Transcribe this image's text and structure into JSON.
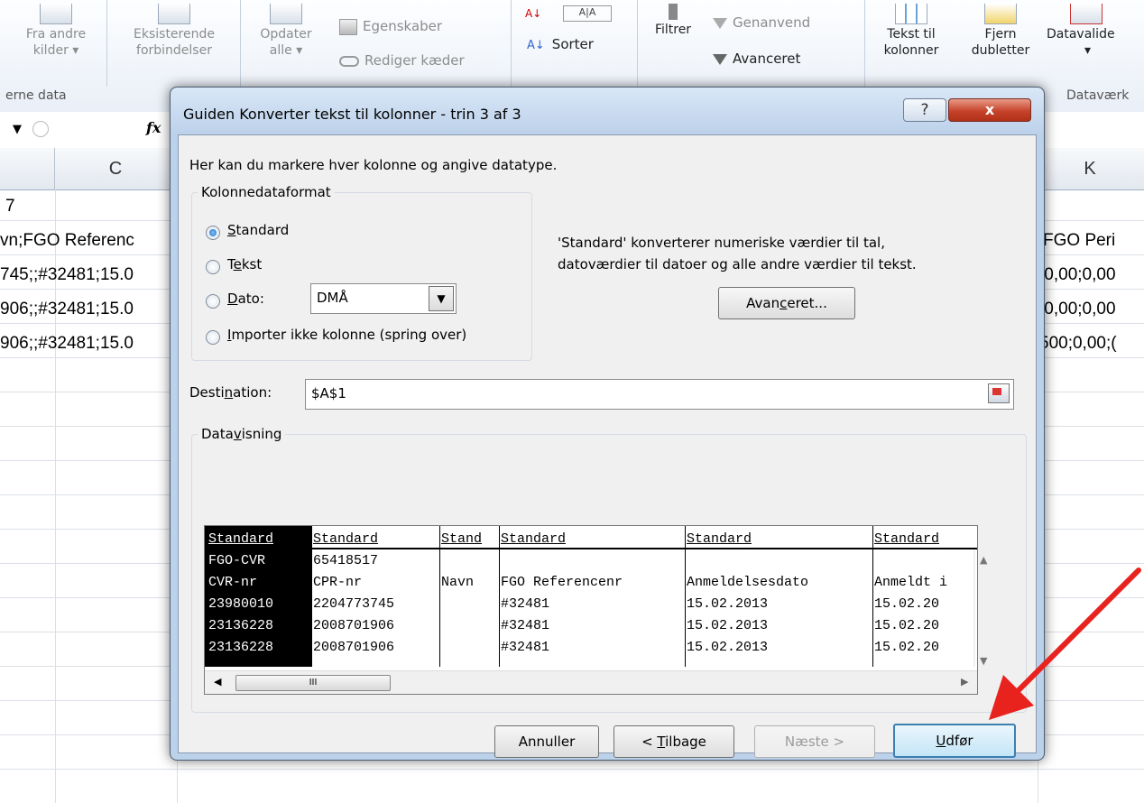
{
  "ribbon": {
    "buttons": [
      {
        "label1": "Fra andre",
        "label2": "kilder ▾"
      },
      {
        "label1": "Eksisterende",
        "label2": "forbindelser"
      },
      {
        "label1": "Opdater",
        "label2": "alle ▾"
      },
      {
        "label1": "Tekst til",
        "label2": "kolonner"
      },
      {
        "label1": "Fjern",
        "label2": "dubletter"
      },
      {
        "label1": "Datavalide",
        "label2": "▾"
      }
    ],
    "small": {
      "egenskaber": "Egenskaber",
      "rediger": "Rediger kæder",
      "sorter": "Sorter",
      "filtrer": "Filtrer",
      "genanvend": "Genanvend",
      "avanceret": "Avanceret"
    },
    "groups": {
      "external": "erne data",
      "datatools": "Dataværk"
    }
  },
  "formula_bar": {
    "fx": "fx"
  },
  "columns": [
    "C",
    "K"
  ],
  "cells": {
    "c1": "7",
    "c2": "vn;FGO Referenc",
    "c3": "745;;#32481;15.0",
    "c4": "906;;#32481;15.0",
    "c5": "906;;#32481;15.0",
    "k2": "FGO Peri",
    "k3": ";0,00;0,00",
    "k4": ";0,00;0,00",
    "k5": "500;0,00;("
  },
  "dialog": {
    "title": "Guiden Konverter tekst til kolonner - trin 3 af 3",
    "help": "?",
    "close": "x",
    "intro": "Her kan du markere hver kolonne og angive datatype.",
    "format_legend": "Kolonnedataformat",
    "radios": [
      {
        "pre": "",
        "u": "S",
        "post": "tandard",
        "selected": true
      },
      {
        "pre": "T",
        "u": "e",
        "post": "kst",
        "selected": false
      },
      {
        "pre": "",
        "u": "D",
        "post": "ato:",
        "selected": false
      },
      {
        "pre": "",
        "u": "I",
        "post": "mporter ikke kolonne (spring over)",
        "selected": false
      }
    ],
    "date_format": "DMÅ",
    "description_line1": "'Standard' konverterer numeriske værdier til tal,",
    "description_line2": "datoværdier til datoer og alle andre værdier til tekst.",
    "advanced_button": {
      "pre": "Avan",
      "u": "c",
      "post": "eret..."
    },
    "destination_label": {
      "pre": "Desti",
      "u": "n",
      "post": "ation:"
    },
    "destination_value": "$A$1",
    "preview_legend": {
      "pre": "Data",
      "u": "v",
      "post": "isning"
    },
    "preview": {
      "headers": [
        "Standard",
        "Standard",
        "Stand",
        "Standard",
        "Standard",
        "Standard"
      ],
      "rows": [
        [
          "FGO-CVR",
          "65418517",
          "",
          "",
          "",
          ""
        ],
        [
          "CVR-nr",
          "CPR-nr",
          "Navn",
          "FGO Referencenr",
          "Anmeldelsesdato",
          "Anmeldt i"
        ],
        [
          "23980010",
          "2204773745",
          "",
          "#32481",
          "15.02.2013",
          "15.02.20"
        ],
        [
          "23136228",
          "2008701906",
          "",
          "#32481",
          "15.02.2013",
          "15.02.20"
        ],
        [
          "23136228",
          "2008701906",
          "",
          "#32481",
          "15.02.2013",
          "15.02.20"
        ]
      ],
      "hscroll_thumb": "III"
    },
    "buttons": {
      "cancel": "Annuller",
      "back": {
        "pre": "< ",
        "u": "T",
        "post": "ilbage"
      },
      "next": "Næste >",
      "finish": {
        "pre": "",
        "u": "U",
        "post": "dfør"
      }
    }
  },
  "colors": {
    "arrow": "#e8231e",
    "selected_column": "#000000",
    "close_button": "#c7432b"
  }
}
